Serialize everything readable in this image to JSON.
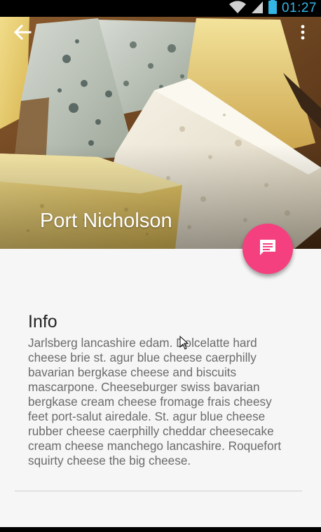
{
  "status_bar": {
    "time": "01:27",
    "icons": [
      "wifi-icon",
      "cell-signal-icon",
      "battery-icon"
    ],
    "time_color": "#33b5e5"
  },
  "toolbar": {
    "back_icon": "arrow-back-icon",
    "overflow_icon": "more-vert-icon"
  },
  "hero": {
    "title": "Port Nicholson",
    "image": "cheese-platter-photo"
  },
  "fab": {
    "icon": "chat-message-icon",
    "color": "#f5407f"
  },
  "info": {
    "heading": "Info",
    "body": "Jarlsberg lancashire edam. Dolcelatte hard cheese brie st. agur blue cheese caerphilly bavarian bergkase cheese and biscuits mascarpone. Cheeseburger swiss bavarian bergkase cream cheese fromage frais cheesy feet port-salut airedale. St. agur blue cheese rubber cheese caerphilly cheddar cheesecake cream cheese manchego lancashire. Roquefort squirty cheese the big cheese."
  }
}
